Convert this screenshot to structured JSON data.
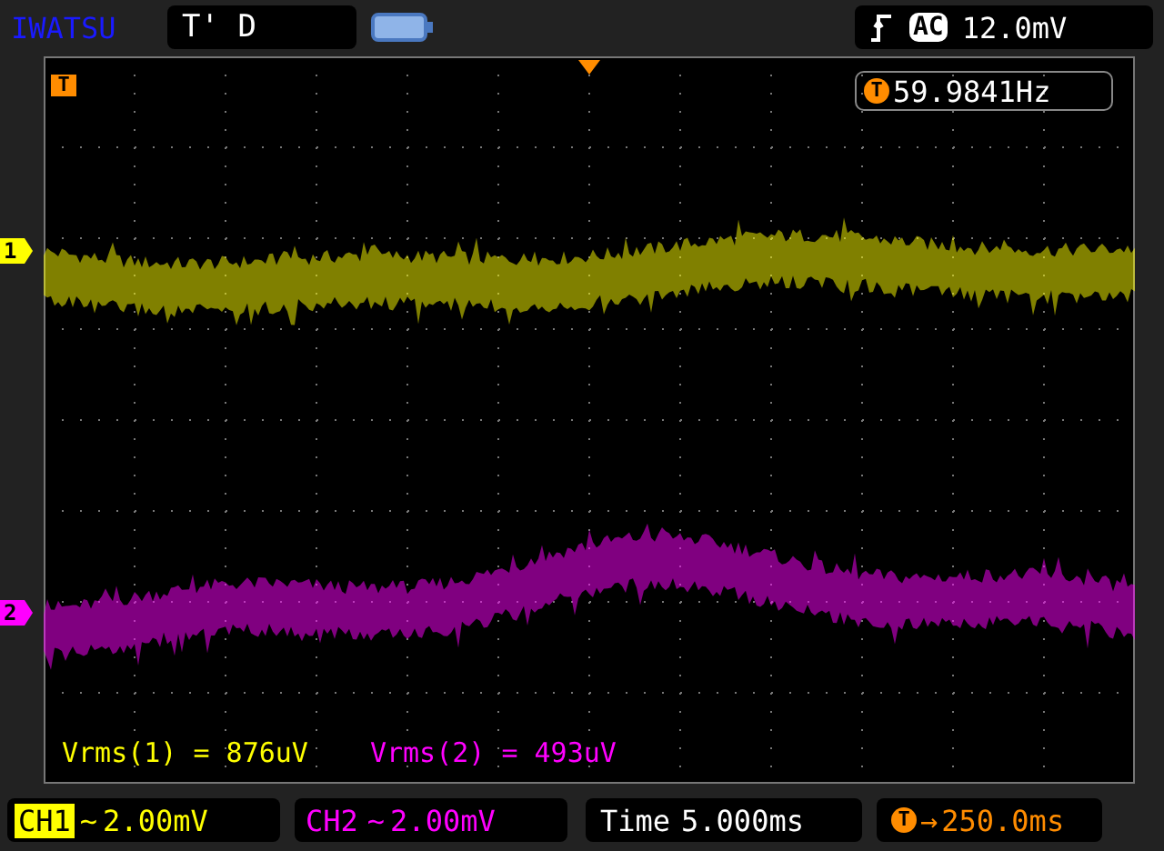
{
  "header": {
    "brand": "IWATSU",
    "mode": "T' D",
    "trigger": {
      "coupling": "AC",
      "level": "12.0mV"
    }
  },
  "frequency": {
    "marker": "T",
    "value": "59.9841Hz"
  },
  "trigger_marker": "T",
  "channels": [
    {
      "marker": "1",
      "color": "#ffff00",
      "measure_label": "Vrms(1) =",
      "measure_value": "876uV",
      "name": "CH1",
      "coupling": "~",
      "scale": "2.00mV"
    },
    {
      "marker": "2",
      "color": "#ff00ff",
      "measure_label": "Vrms(2) =",
      "measure_value": "493uV",
      "name": "CH2",
      "coupling": "~",
      "scale": "2.00mV"
    }
  ],
  "timebase": {
    "label": "Time",
    "value": "5.000ms"
  },
  "trigger_delay": {
    "marker": "T",
    "arrow": "→",
    "value": "250.0ms"
  }
}
